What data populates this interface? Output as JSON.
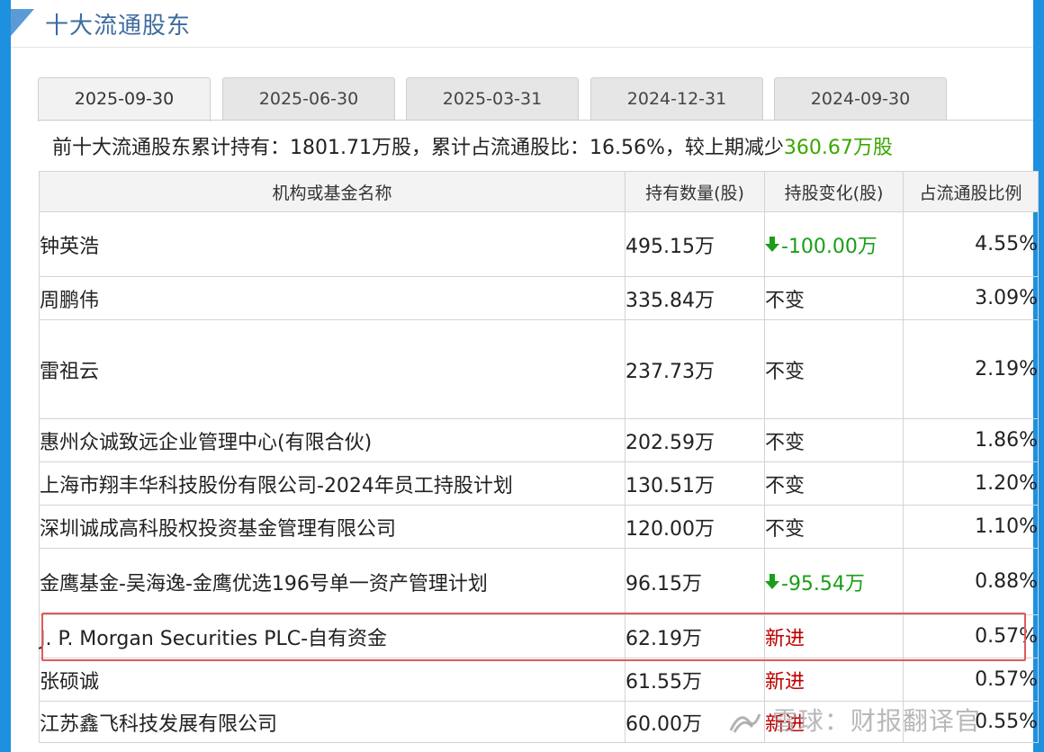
{
  "section_title": "十大流通股东",
  "tabs": [
    {
      "label": "2025-09-30",
      "active": true
    },
    {
      "label": "2025-06-30",
      "active": false
    },
    {
      "label": "2025-03-31",
      "active": false
    },
    {
      "label": "2024-12-31",
      "active": false
    },
    {
      "label": "2024-09-30",
      "active": false
    }
  ],
  "summary": {
    "prefix": "前十大流通股东累计持有：1801.71万股，累计占流通股比：16.56%，较上期减少",
    "change": "360.67万股"
  },
  "table": {
    "headers": [
      "机构或基金名称",
      "持有数量(股)",
      "持股变化(股)",
      "占流通股比例"
    ],
    "rows": [
      {
        "name": "钟英浩",
        "qty": "495.15万",
        "change": "-100.00万",
        "change_type": "down",
        "pct": "4.55%"
      },
      {
        "name": "周鹏伟",
        "qty": "335.84万",
        "change": "不变",
        "change_type": "same",
        "pct": "3.09%"
      },
      {
        "name": "雷祖云",
        "qty": "237.73万",
        "change": "不变",
        "change_type": "same",
        "pct": "2.19%"
      },
      {
        "name": "惠州众诚致远企业管理中心(有限合伙)",
        "qty": "202.59万",
        "change": "不变",
        "change_type": "same",
        "pct": "1.86%"
      },
      {
        "name": "上海市翔丰华科技股份有限公司-2024年员工持股计划",
        "qty": "130.51万",
        "change": "不变",
        "change_type": "same",
        "pct": "1.20%"
      },
      {
        "name": "深圳诚成高科股权投资基金管理有限公司",
        "qty": "120.00万",
        "change": "不变",
        "change_type": "same",
        "pct": "1.10%"
      },
      {
        "name": "金鹰基金-吴海逸-金鹰优选196号单一资产管理计划",
        "qty": "96.15万",
        "change": "-95.54万",
        "change_type": "down",
        "pct": "0.88%"
      },
      {
        "name": "J. P. Morgan Securities PLC-自有资金",
        "qty": "62.19万",
        "change": "新进",
        "change_type": "new",
        "pct": "0.57%"
      },
      {
        "name": "张硕诚",
        "qty": "61.55万",
        "change": "新进",
        "change_type": "new",
        "pct": "0.57%"
      },
      {
        "name": "江苏鑫飞科技发展有限公司",
        "qty": "60.00万",
        "change": "新进",
        "change_type": "new",
        "pct": "0.55%"
      }
    ]
  },
  "watermark": "雪球：财报翻译官",
  "colors": {
    "accent_blue": "#3d6c9e",
    "decrease_green": "#1a9e1a",
    "new_red": "#c00000",
    "highlight_red": "#e05a5a",
    "border_blue": "#1e90e0"
  }
}
